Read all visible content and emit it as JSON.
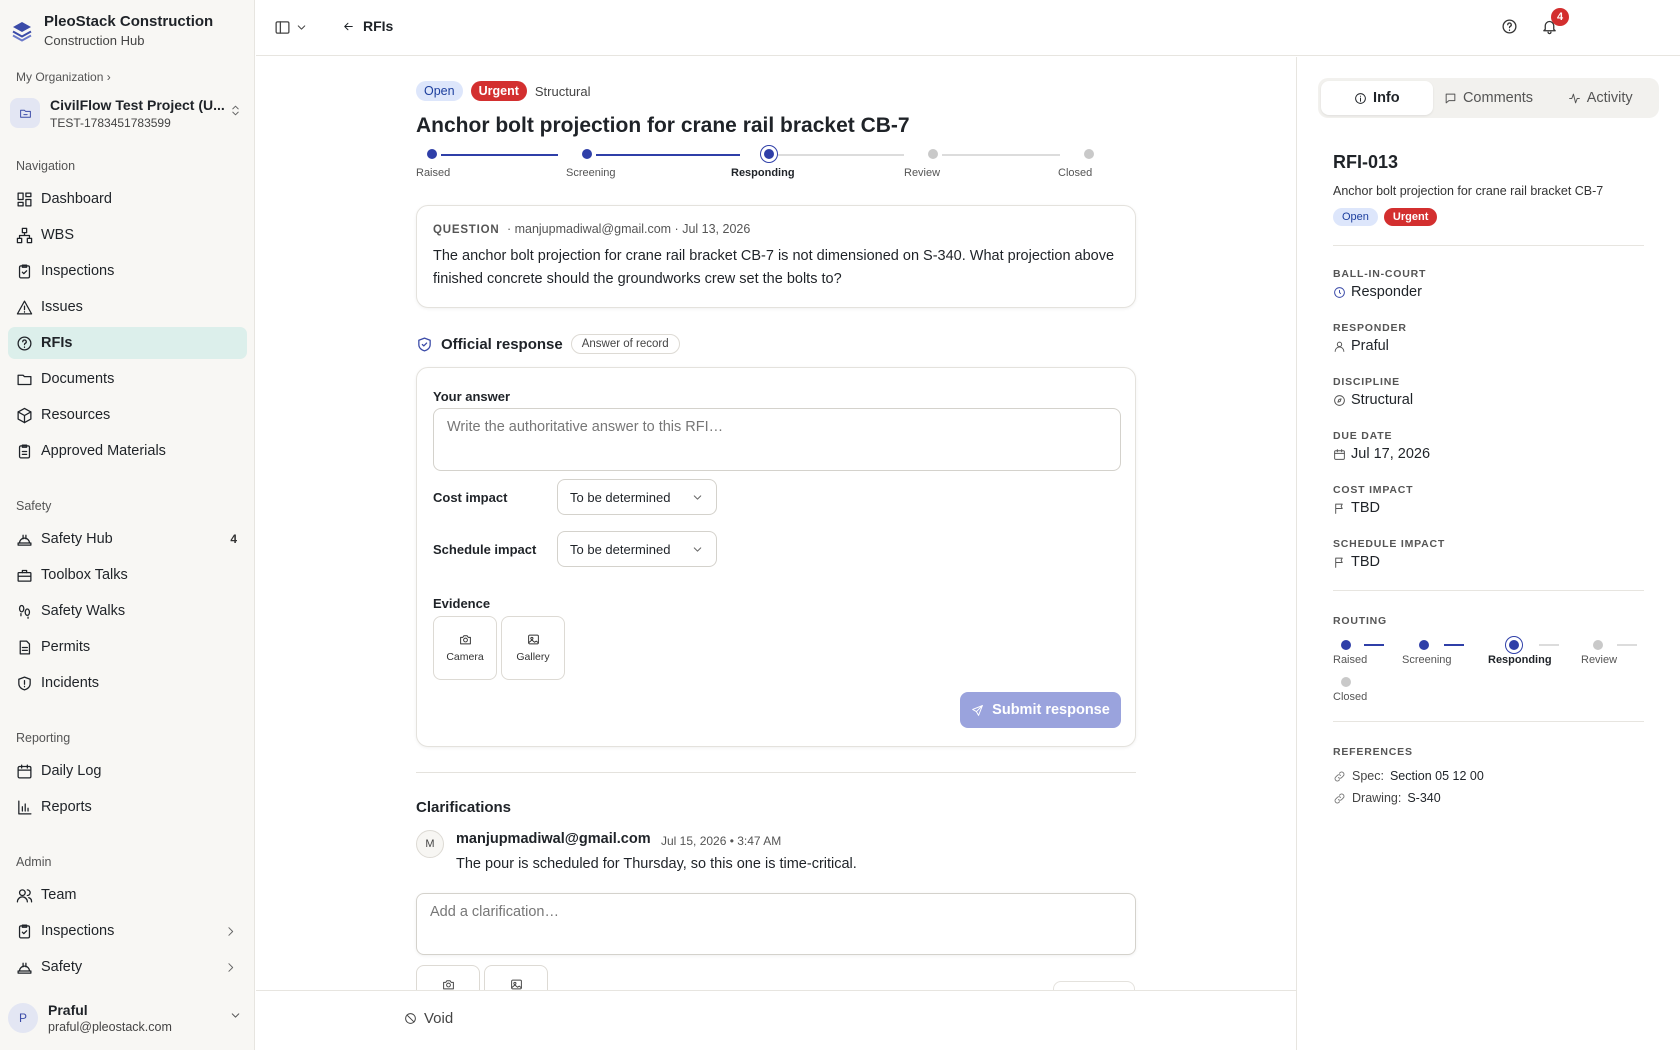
{
  "brand": {
    "name": "PleoStack Construction",
    "sub": "Construction Hub"
  },
  "org": {
    "crumb": "My Organization ›"
  },
  "project": {
    "name": "CivilFlow Test Project (U...",
    "code": "TEST-1783451783599"
  },
  "sidebar": {
    "nav_label": "Navigation",
    "nav": [
      {
        "label": "Dashboard",
        "icon": "dashboard-icon"
      },
      {
        "label": "WBS",
        "icon": "wbs-icon"
      },
      {
        "label": "Inspections",
        "icon": "clipboard-icon"
      },
      {
        "label": "Issues",
        "icon": "warning-icon"
      },
      {
        "label": "RFIs",
        "icon": "question-icon",
        "active": true
      },
      {
        "label": "Documents",
        "icon": "folder-icon"
      },
      {
        "label": "Resources",
        "icon": "box-icon"
      },
      {
        "label": "Approved Materials",
        "icon": "clipboard-check-icon"
      }
    ],
    "safety_label": "Safety",
    "safety": [
      {
        "label": "Safety Hub",
        "badge": "4"
      },
      {
        "label": "Toolbox Talks"
      },
      {
        "label": "Safety Walks"
      },
      {
        "label": "Permits"
      },
      {
        "label": "Incidents"
      }
    ],
    "reporting_label": "Reporting",
    "reporting": [
      {
        "label": "Daily Log"
      },
      {
        "label": "Reports"
      }
    ],
    "admin_label": "Admin",
    "admin": [
      {
        "label": "Team"
      },
      {
        "label": "Inspections"
      },
      {
        "label": "Safety"
      }
    ]
  },
  "user": {
    "initial": "P",
    "name": "Praful",
    "email": "praful@pleostack.com"
  },
  "topbar": {
    "back_label": "RFIs",
    "notif_count": "4"
  },
  "rfi": {
    "status": "Open",
    "priority": "Urgent",
    "discipline": "Structural",
    "title": "Anchor bolt projection for crane rail bracket CB-7",
    "steps": [
      "Raised",
      "Screening",
      "Responding",
      "Review",
      "Closed"
    ],
    "current_step_index": 2
  },
  "question": {
    "label": "QUESTION",
    "meta": "· manjupmadiwal@gmail.com · Jul 13, 2026",
    "text": "The anchor bolt projection for crane rail bracket CB-7 is not dimensioned on S-340. What projection above finished concrete should the groundworks crew set the bolts to?"
  },
  "response": {
    "title": "Official response",
    "tag": "Answer of record",
    "answer_label": "Your answer",
    "answer_placeholder": "Write the authoritative answer to this RFI…",
    "cost_label": "Cost impact",
    "cost_value": "To be determined",
    "schedule_label": "Schedule impact",
    "schedule_value": "To be determined",
    "evidence_label": "Evidence",
    "camera_label": "Camera",
    "gallery_label": "Gallery",
    "submit_label": "Submit response"
  },
  "clarifications": {
    "title": "Clarifications",
    "items": [
      {
        "initial": "M",
        "author": "manjupmadiwal@gmail.com",
        "time": "Jul 15, 2026 • 3:47 AM",
        "body": "The pour is scheduled for Thursday, so this one is time-critical."
      }
    ],
    "input_placeholder": "Add a clarification…"
  },
  "footer": {
    "void_label": "Void"
  },
  "panel": {
    "tabs": [
      "Info",
      "Comments",
      "Activity"
    ],
    "id": "RFI-013",
    "subtitle": "Anchor bolt projection for crane rail bracket CB-7",
    "status": "Open",
    "priority": "Urgent",
    "fields": [
      {
        "label": "BALL-IN-COURT",
        "value": "Responder"
      },
      {
        "label": "RESPONDER",
        "value": "Praful"
      },
      {
        "label": "DISCIPLINE",
        "value": "Structural"
      },
      {
        "label": "DUE DATE",
        "value": "Jul 17, 2026"
      },
      {
        "label": "COST IMPACT",
        "value": "TBD"
      },
      {
        "label": "SCHEDULE IMPACT",
        "value": "TBD"
      }
    ],
    "routing_label": "ROUTING",
    "references_label": "REFERENCES",
    "references": [
      {
        "key": "Spec:",
        "value": "Section 05 12 00"
      },
      {
        "key": "Drawing:",
        "value": "S-340"
      }
    ]
  },
  "colors": {
    "accent": "#2f3fa8",
    "urgent": "#d32f2f",
    "open_bg": "#dde6fb",
    "active_nav": "#dcefeb"
  }
}
